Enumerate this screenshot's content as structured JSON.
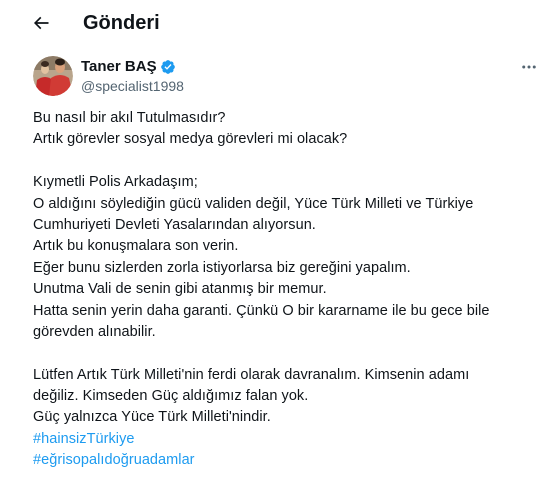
{
  "header": {
    "back_icon": "arrow-left-icon",
    "title": "Gönderi"
  },
  "author": {
    "name": "Taner BAŞ",
    "handle": "@specialist1998",
    "verified_icon": "verified-badge-icon",
    "avatar": "avatar-photo"
  },
  "more_icon": "more-horizontal-icon",
  "tweet": {
    "paragraph1": [
      "Bu nasıl bir akıl Tutulmasıdır?",
      "Artık görevler sosyal medya görevleri mi olacak?"
    ],
    "paragraph2": [
      "Kıymetli Polis Arkadaşım;",
      "O aldığını söylediğin gücü validen değil, Yüce Türk Milleti ve Türkiye",
      "Cumhuriyeti Devleti Yasalarından alıyorsun.",
      "Artık bu konuşmalara son verin.",
      "Eğer bunu sizlerden zorla istiyorlarsa biz gereğini yapalım.",
      "Unutma Vali de senin gibi atanmış bir memur.",
      "Hatta senin yerin daha garanti. Çünkü O bir kararname ile bu gece bile",
      "görevden alınabilir."
    ],
    "paragraph3": [
      "Lütfen Artık Türk Milleti'nin ferdi olarak davranalım. Kimsenin adamı",
      "değiliz. Kimseden Güç aldığımız falan yok.",
      "Güç yalnızca Yüce Türk Milleti'nindir."
    ],
    "hashtags": [
      "#hainsizTürkiye",
      "#eğrisopalıdoğruadamlar"
    ]
  },
  "colors": {
    "text": "#0f1419",
    "secondary": "#536471",
    "link": "#1d9bf0"
  }
}
